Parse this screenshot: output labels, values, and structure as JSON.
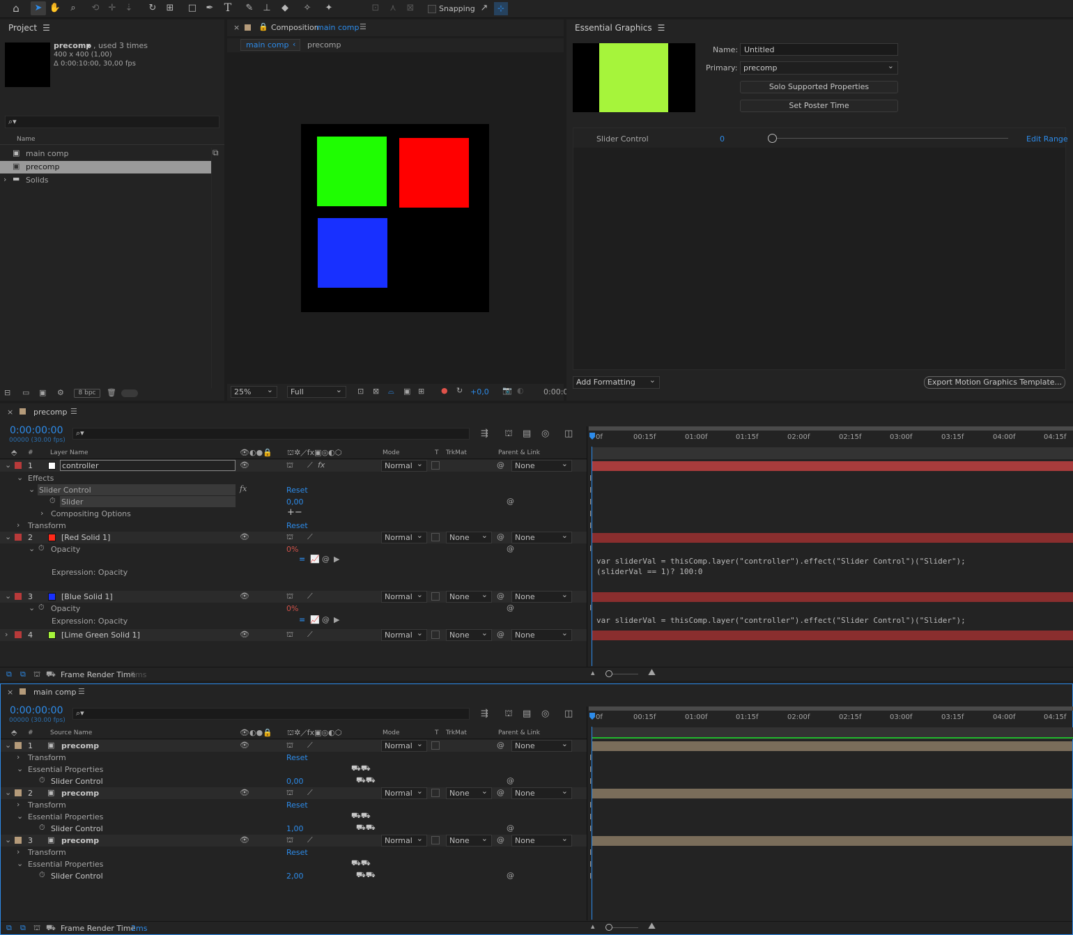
{
  "toolbar": {
    "snapping_label": "Snapping"
  },
  "project": {
    "tab": "Project",
    "item_name": "precomp",
    "item_used": ", used 3 times",
    "item_size": "400 x 400 (1,00)",
    "item_duration": "Δ 0:00:10:00, 30,00 fps",
    "col_name": "Name",
    "items": [
      {
        "label": "main comp"
      },
      {
        "label": "precomp"
      },
      {
        "label": "Solids"
      }
    ],
    "bpc": "8 bpc"
  },
  "composition": {
    "tab_prefix": "Composition",
    "tab_name": "main comp",
    "crumb1": "main comp",
    "crumb2": "precomp",
    "zoom": "25%",
    "resolution": "Full",
    "exposure": "+0,0",
    "time": "0:00:0"
  },
  "eg": {
    "tab": "Essential Graphics",
    "name_label": "Name:",
    "name_value": "Untitled",
    "primary_label": "Primary:",
    "primary_value": "precomp",
    "solo_btn": "Solo Supported Properties",
    "poster_btn": "Set Poster Time",
    "slider_label": "Slider Control",
    "slider_value": "0",
    "edit_range": "Edit Range",
    "add_formatting": "Add Formatting",
    "export_btn": "Export Motion Graphics Template..."
  },
  "tl1": {
    "tab": "precomp",
    "timecode": "0:00:00:00",
    "frames": "00000 (30.00 fps)",
    "col_layer": "Layer Name",
    "col_mode": "Mode",
    "col_t": "T",
    "col_trk": "TrkMat",
    "col_parent": "Parent & Link",
    "ruler": [
      "0f",
      "00:15f",
      "01:00f",
      "01:15f",
      "02:00f",
      "02:15f",
      "03:00f",
      "03:15f",
      "04:00f",
      "04:15f"
    ],
    "layers": [
      {
        "num": "1",
        "name": "controller",
        "mode": "Normal",
        "parent": "None"
      },
      {
        "num": "2",
        "name": "[Red Solid 1]",
        "mode": "Normal",
        "trk": "None",
        "parent": "None"
      },
      {
        "num": "3",
        "name": "[Blue Solid 1]",
        "mode": "Normal",
        "trk": "None",
        "parent": "None"
      },
      {
        "num": "4",
        "name": "[Lime Green Solid 1]",
        "mode": "Normal",
        "trk": "None",
        "parent": "None"
      }
    ],
    "effects": "Effects",
    "slider_control": "Slider Control",
    "slider": "Slider",
    "slider_value": "0,00",
    "compositing": "Compositing Options",
    "transform": "Transform",
    "reset": "Reset",
    "opacity": "Opacity",
    "opacity_red": "0%",
    "opacity_blue": "0%",
    "expr_label": "Expression: Opacity",
    "expr_red_1": "var sliderVal = thisComp.layer(\"controller\").effect(\"Slider Control\")(\"Slider\");",
    "expr_red_2": "(sliderVal == 1)? 100:0",
    "expr_blue_1": "var sliderVal = thisComp.layer(\"controller\").effect(\"Slider Control\")(\"Slider\");",
    "render_label": "Frame Render Time",
    "render_value": "0ms"
  },
  "tl2": {
    "tab": "main comp",
    "timecode": "0:00:00:00",
    "frames": "00000 (30.00 fps)",
    "col_source": "Source Name",
    "col_mode": "Mode",
    "col_t": "T",
    "col_trk": "TrkMat",
    "col_parent": "Parent & Link",
    "ruler": [
      "0f",
      "00:15f",
      "01:00f",
      "01:15f",
      "02:00f",
      "02:15f",
      "03:00f",
      "03:15f",
      "04:00f",
      "04:15f"
    ],
    "layers": [
      {
        "num": "1",
        "name": "precomp",
        "mode": "Normal",
        "parent": "None",
        "slider": "0,00"
      },
      {
        "num": "2",
        "name": "precomp",
        "mode": "Normal",
        "trk": "None",
        "parent": "None",
        "slider": "1,00"
      },
      {
        "num": "3",
        "name": "precomp",
        "mode": "Normal",
        "trk": "None",
        "parent": "None",
        "slider": "2,00"
      }
    ],
    "transform": "Transform",
    "reset": "Reset",
    "essential": "Essential Properties",
    "slider_control": "Slider Control",
    "render_label": "Frame Render Time",
    "render_value": "2ms"
  },
  "colors": {
    "accent": "#2d8ceb",
    "label_red": "#b83a3a",
    "label_tan": "#b59b7a",
    "green": "#1ffd02",
    "red": "#ff0000",
    "blue": "#1830ff",
    "lime": "#a6f43b"
  }
}
